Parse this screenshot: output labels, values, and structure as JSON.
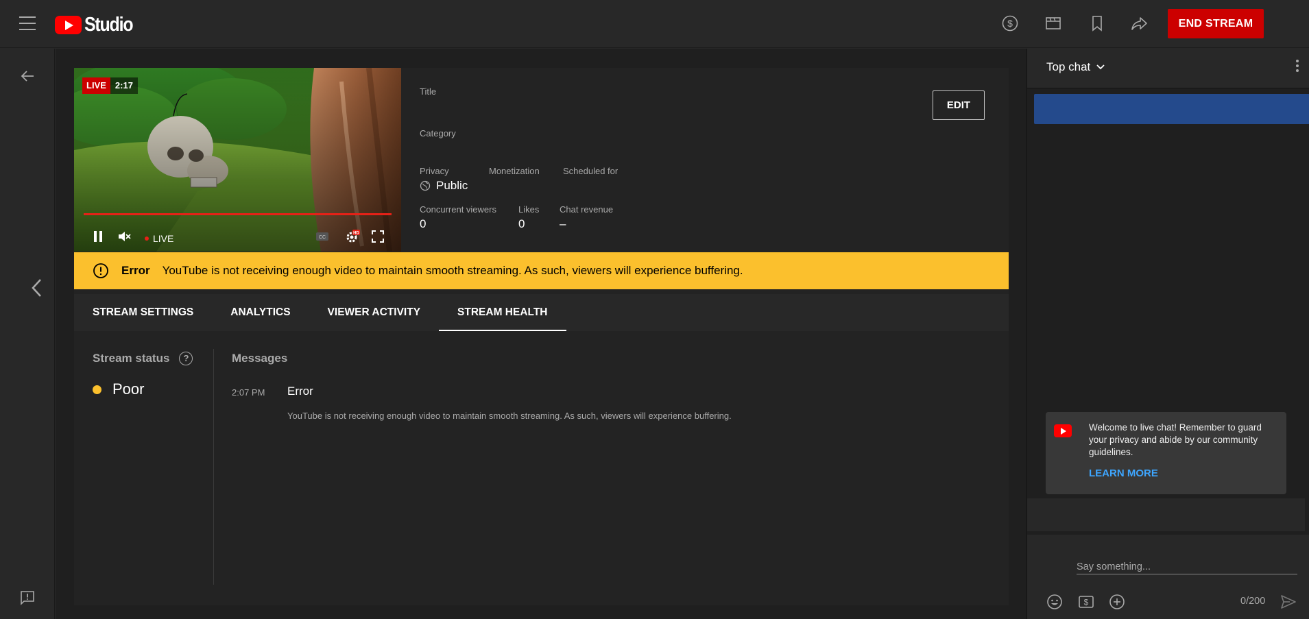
{
  "header": {
    "logo_text": "Studio",
    "end_stream_label": "END STREAM"
  },
  "video": {
    "live_label": "LIVE",
    "time": "2:17",
    "control_live_label": "LIVE"
  },
  "info": {
    "title_label": "Title",
    "category_label": "Category",
    "privacy_label": "Privacy",
    "privacy_value": "Public",
    "monetization_label": "Monetization",
    "scheduled_label": "Scheduled for",
    "viewers_label": "Concurrent viewers",
    "viewers_value": "0",
    "likes_label": "Likes",
    "likes_value": "0",
    "revenue_label": "Chat revenue",
    "revenue_value": "–",
    "edit_label": "EDIT"
  },
  "error_bar": {
    "title": "Error",
    "message": "YouTube is not receiving enough video to maintain smooth streaming. As such, viewers will experience buffering."
  },
  "tabs": [
    {
      "label": "STREAM SETTINGS"
    },
    {
      "label": "ANALYTICS"
    },
    {
      "label": "VIEWER ACTIVITY"
    },
    {
      "label": "STREAM HEALTH"
    }
  ],
  "health": {
    "status_title": "Stream status",
    "status_value": "Poor",
    "messages_title": "Messages",
    "message": {
      "time": "2:07 PM",
      "title": "Error",
      "body": "YouTube is not receiving enough video to maintain smooth streaming. As such, viewers will experience buffering."
    }
  },
  "chat": {
    "mode": "Top chat",
    "welcome_text": "Welcome to live chat! Remember to guard your privacy and abide by our community guidelines.",
    "learn_more": "LEARN MORE",
    "input_placeholder": "Say something...",
    "char_count": "0/200"
  },
  "colors": {
    "end_stream": "#cc0000",
    "warning": "#fbc02d",
    "link": "#3ea6ff",
    "pinned": "#244a8c"
  }
}
